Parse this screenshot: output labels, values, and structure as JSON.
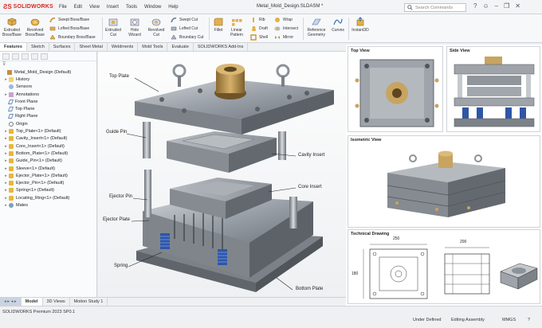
{
  "app": {
    "brand": "SOLIDWORKS",
    "doc_title": "Metal_Mold_Design.SLDASM *",
    "search_placeholder": "Search Commands"
  },
  "menu": [
    "File",
    "Edit",
    "View",
    "Insert",
    "Tools",
    "Window",
    "Help"
  ],
  "ribbon": {
    "big": [
      {
        "label": "Extruded Boss/Base",
        "icon": "extruded-boss-icon"
      },
      {
        "label": "Revolved Boss/Base",
        "icon": "revolved-boss-icon"
      },
      {
        "label": "Extruded Cut",
        "icon": "extruded-cut-icon"
      },
      {
        "label": "Hole Wizard",
        "icon": "hole-wizard-icon"
      },
      {
        "label": "Revolved Cut",
        "icon": "revolved-cut-icon"
      },
      {
        "label": "Fillet",
        "icon": "fillet-icon"
      },
      {
        "label": "Linear Pattern",
        "icon": "linear-pattern-icon"
      },
      {
        "label": "Reference Geometry",
        "icon": "reference-geometry-icon"
      },
      {
        "label": "Curves",
        "icon": "curves-icon"
      },
      {
        "label": "Instant3D",
        "icon": "instant3d-icon"
      }
    ],
    "small": [
      "Swept Boss/Base",
      "Lofted Boss/Base",
      "Boundary Boss/Base",
      "Swept Cut",
      "Lofted Cut",
      "Boundary Cut",
      "Rib",
      "Draft",
      "Shell",
      "Wrap",
      "Intersect",
      "Mirror"
    ]
  },
  "tabs": [
    "Features",
    "Sketch",
    "Surfaces",
    "Sheet Metal",
    "Weldments",
    "Mold Tools",
    "Evaluate",
    "SOLIDWORKS Add-Ins"
  ],
  "active_tab": "Features",
  "tree": [
    {
      "label": "Metal_Mold_Design (Default)",
      "type": "asm",
      "tw": ""
    },
    {
      "label": "History",
      "type": "folder",
      "tw": "▸"
    },
    {
      "label": "Sensors",
      "type": "sensor",
      "tw": ""
    },
    {
      "label": "Annotations",
      "type": "ann",
      "tw": "▸"
    },
    {
      "label": "Front Plane",
      "type": "plane",
      "tw": ""
    },
    {
      "label": "Top Plane",
      "type": "plane",
      "tw": ""
    },
    {
      "label": "Right Plane",
      "type": "plane",
      "tw": ""
    },
    {
      "label": "Origin",
      "type": "origin",
      "tw": ""
    },
    {
      "label": "Top_Plate<1> (Default)",
      "type": "part",
      "tw": "▸"
    },
    {
      "label": "Cavity_Insert<1> (Default)",
      "type": "part",
      "tw": "▸"
    },
    {
      "label": "Core_Insert<1> (Default)",
      "type": "part",
      "tw": "▸"
    },
    {
      "label": "Bottom_Plate<1> (Default)",
      "type": "part",
      "tw": "▸"
    },
    {
      "label": "Guide_Pin<1> (Default)",
      "type": "part",
      "tw": "▸"
    },
    {
      "label": "Sleeve<1> (Default)",
      "type": "part",
      "tw": "▸"
    },
    {
      "label": "Ejector_Plate<1> (Default)",
      "type": "part",
      "tw": "▸"
    },
    {
      "label": "Ejector_Pin<1> (Default)",
      "type": "part",
      "tw": "▸"
    },
    {
      "label": "Spring<1> (Default)",
      "type": "part",
      "tw": "▸"
    },
    {
      "label": "Locating_Ring<1> (Default)",
      "type": "part",
      "tw": "▸"
    },
    {
      "label": "Mates",
      "type": "mate",
      "tw": "▸"
    }
  ],
  "callouts": {
    "top_plate": "Top Plate",
    "guide_pin": "Guide Pin",
    "cavity_insert": "Cavity Insert",
    "core_insert": "Core Insert",
    "ejector_pin": "Ejector Pin",
    "ejector_plate": "Ejector Plate",
    "spring": "Spring",
    "bottom_plate": "Bottom Plate"
  },
  "panels": {
    "top": "Top View",
    "side": "Side View",
    "iso": "Isometric View",
    "tech": "Technical Drawing"
  },
  "drawing_dims": {
    "width": "250",
    "height": "180",
    "side_width": "200"
  },
  "bottom_tabs": [
    "Model",
    "3D Views",
    "Motion Study 1"
  ],
  "status": {
    "version": "SOLIDWORKS Premium 2023 SP0.1",
    "state": "Under Defined",
    "mode": "Editing Assembly",
    "units": "MMGS"
  },
  "colors": {
    "brand": "#d8261f",
    "steel": "#9aa0a7",
    "brass": "#b8904a",
    "spring": "#2f56a6"
  }
}
